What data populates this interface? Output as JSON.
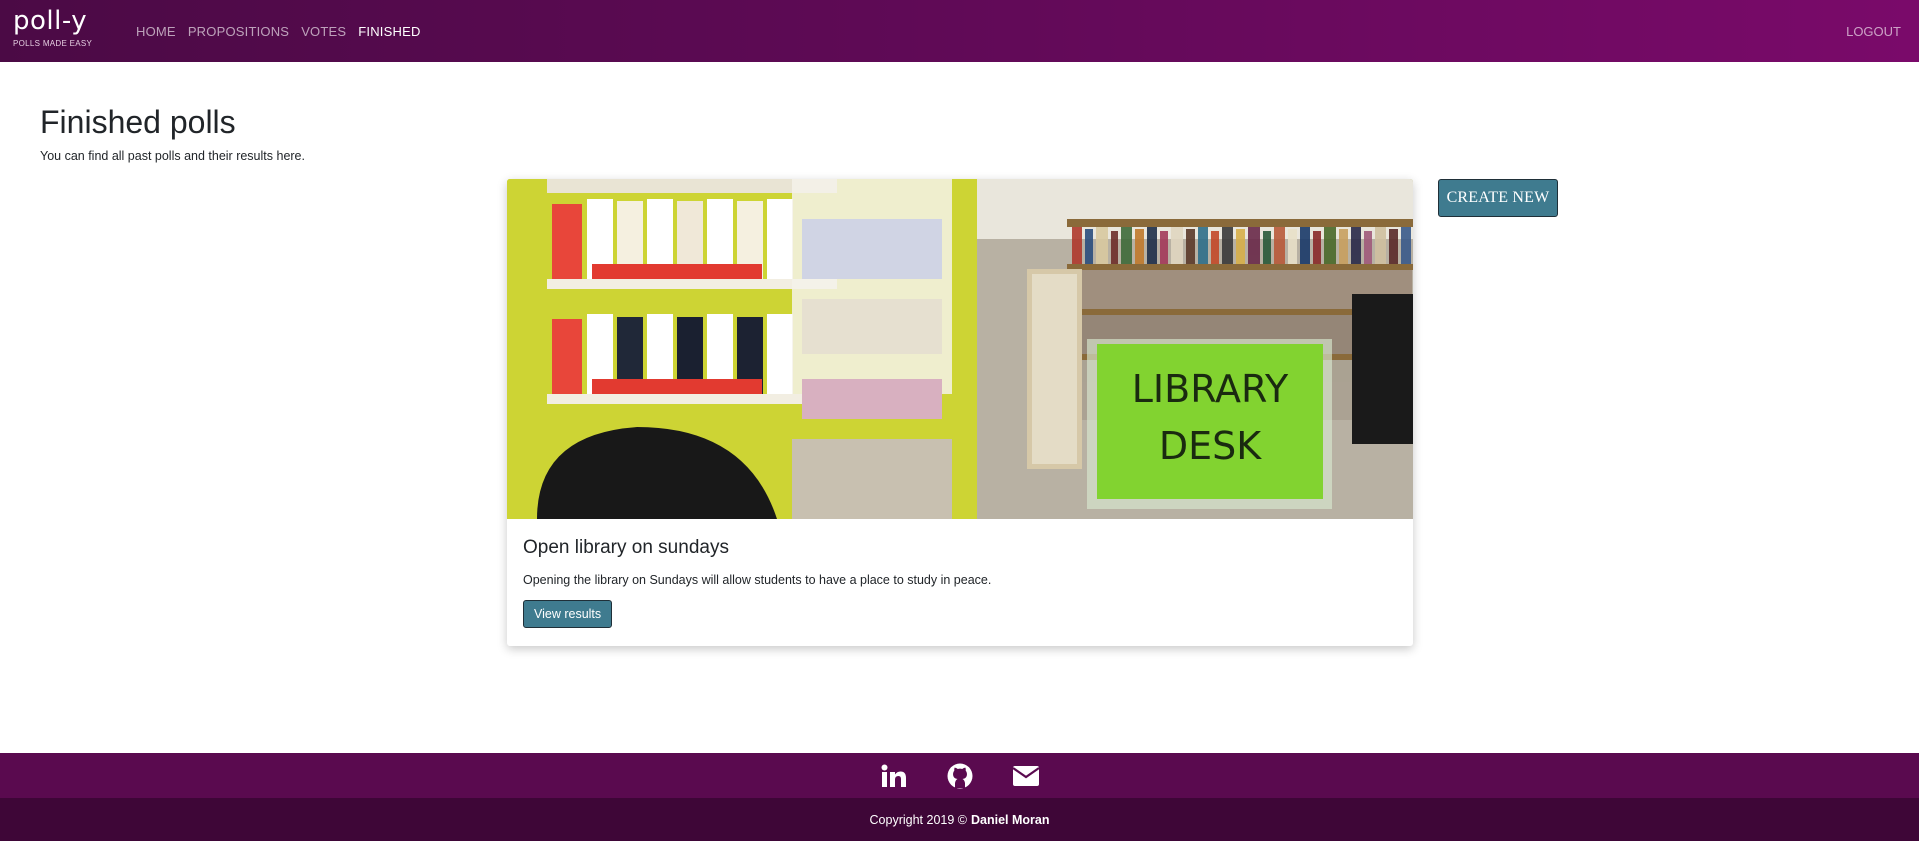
{
  "brand": {
    "name": "poll-y",
    "tagline": "POLLS MADE EASY"
  },
  "nav": {
    "items": [
      {
        "label": "HOME",
        "active": false
      },
      {
        "label": "PROPOSITIONS",
        "active": false
      },
      {
        "label": "VOTES",
        "active": false
      },
      {
        "label": "FINISHED",
        "active": true
      }
    ],
    "logout_label": "LOGOUT"
  },
  "page": {
    "title": "Finished polls",
    "subtitle": "You can find all past polls and their results here."
  },
  "actions": {
    "create_new_label": "CREATE NEW"
  },
  "polls": [
    {
      "title": "Open library on sundays",
      "description": "Opening the library on Sundays will allow students to have a place to study in peace.",
      "button_label": "View results",
      "image_sign_text": [
        "LIBRARY",
        "DESK"
      ]
    }
  ],
  "footer": {
    "social_icons": [
      "linkedin-icon",
      "github-icon",
      "mail-icon"
    ],
    "copyright_prefix": "Copyright 2019 ©",
    "copyright_name": "Daniel Moran"
  },
  "colors": {
    "nav_start": "#4b0a45",
    "nav_end": "#7a0a6a",
    "button": "#3f7b8f",
    "footer_top": "#5a0a4f",
    "footer_bottom": "#3e0637"
  }
}
